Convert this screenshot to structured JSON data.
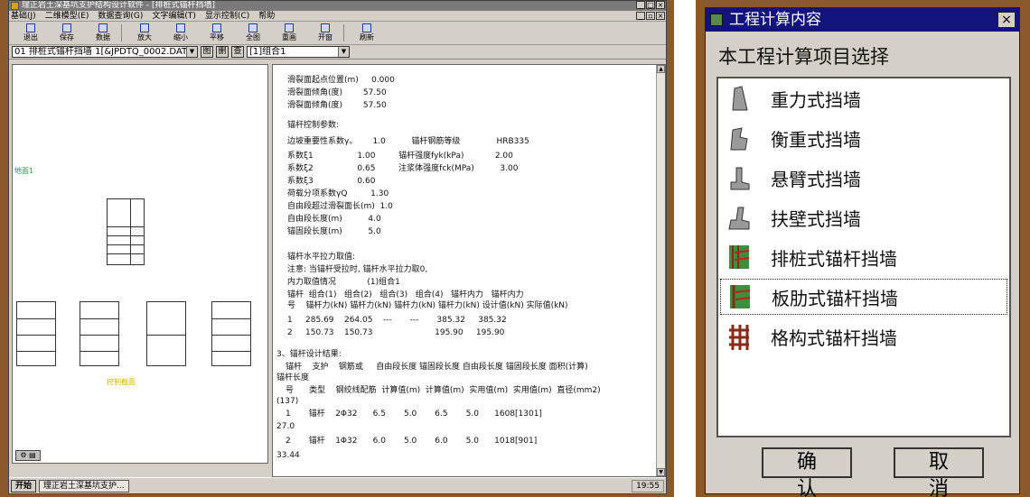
{
  "app": {
    "title": "理正岩土深基坑支护结构设计软件 - [排桩式锚杆挡墙]",
    "menu": [
      "基础(J)",
      "二维模型(E)",
      "数据查询(G)",
      "文字编辑(T)",
      "显示控制(C)",
      "帮助"
    ],
    "toolbar": [
      "退出",
      "保存",
      "数据",
      "放大",
      "缩小",
      "平移",
      "全图",
      "重画",
      "开窗",
      "刷新"
    ],
    "file_combo": "01  排桩式锚杆挡墙 1[&JPDTQ_0002.DAT",
    "filebar_buttons": [
      "图",
      "删",
      "查"
    ],
    "case_combo": "[1]组合1",
    "left_tags": {
      "green": "地面1",
      "yellow": "控制截面"
    },
    "left_tab": "⚙ ▤",
    "results_lines": [
      "滑裂面起点位置(m)     0.000",
      "滑裂面倾角(度)        57.50",
      "滑裂面倾角(度)        57.50",
      "锚杆控制参数:",
      "边坡重要性系数γ。      1.0          锚杆钢筋等级              HRB335",
      "系数ξ1                 1.00         锚杆强度fyk(kPa)            2.00",
      "系数ξ2                 0.65         注浆体强度fck(MPa)          3.00",
      "系数ξ3                 0.60",
      "荷载分项系数γQ         1.30",
      "自由段超过滑裂面长(m)  1.0",
      "自由段长度(m)          4.0",
      "锚固段长度(m)          5.0",
      "锚杆水平拉力取值:",
      "注意: 当锚杆受拉时, 锚杆水平拉力取0,",
      "内力取值情况            (1)组合1",
      "锚杆  组合(1)   组合(2)   组合(3)   组合(4)   锚杆内力   锚杆内力",
      "号    锚杆力(kN) 锚杆力(kN) 锚杆力(kN) 锚杆力(kN) 设计值(kN) 实际值(kN)",
      "1     285.69    264.05    ---       ---       385.32     385.32",
      "2     150.73    150.73                        195.90     195.90",
      "3、锚杆设计结果:",
      "锚杆    支护    钢筋或     自由段长度 锚固段长度 自由段长度 锚固段长度 面积(计算)",
      "锚杆长度",
      "号      类型    钢绞线配筋  计算值(m)  计算值(m)  实用值(m)  实用值(m)  直径(mm2)",
      "(137)",
      "1       锚杆    2Φ32      6.5       5.0       6.5       5.0      1608[1301]",
      "27.0",
      "2       锚杆    1Φ32      6.0       5.0       6.0       5.0      1018[901]",
      "33.44"
    ],
    "taskbar": {
      "start": "开始",
      "task": "理正岩土深基坑支护...",
      "tray": "19:55"
    }
  },
  "dialog": {
    "title": "工程计算内容",
    "prompt": "本工程计算项目选择",
    "items": [
      {
        "label": "重力式挡墙",
        "icon": "gravity-wall-icon"
      },
      {
        "label": "衡重式挡墙",
        "icon": "balance-wall-icon"
      },
      {
        "label": "悬臂式挡墙",
        "icon": "cantilever-wall-icon"
      },
      {
        "label": "扶壁式挡墙",
        "icon": "counterfort-wall-icon"
      },
      {
        "label": "排桩式锚杆挡墙",
        "icon": "pile-anchor-wall-icon"
      },
      {
        "label": "板肋式锚杆挡墙",
        "icon": "rib-anchor-wall-icon"
      },
      {
        "label": "格构式锚杆挡墙",
        "icon": "lattice-anchor-wall-icon"
      }
    ],
    "selected_index": 5,
    "ok_label": "确认",
    "cancel_label": "取消",
    "close_label": "×"
  }
}
